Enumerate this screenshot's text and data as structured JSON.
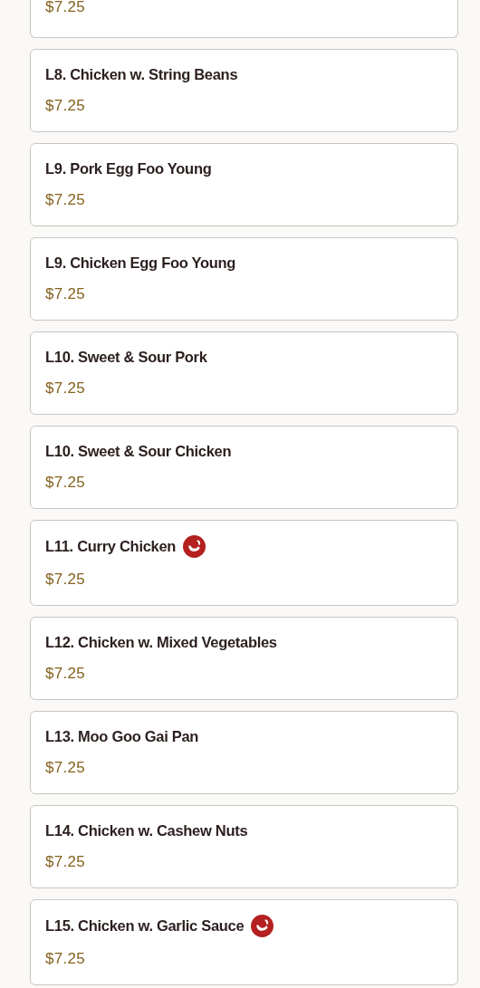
{
  "menu_items": [
    {
      "price": "$7.25",
      "cut": true
    },
    {
      "name": "L8. Chicken w. String Beans",
      "price": "$7.25",
      "spicy": false
    },
    {
      "name": "L9. Pork Egg Foo Young",
      "price": "$7.25",
      "spicy": false
    },
    {
      "name": "L9. Chicken Egg Foo Young",
      "price": "$7.25",
      "spicy": false
    },
    {
      "name": "L10. Sweet & Sour Pork",
      "price": "$7.25",
      "spicy": false
    },
    {
      "name": "L10. Sweet & Sour Chicken",
      "price": "$7.25",
      "spicy": false
    },
    {
      "name": "L11. Curry Chicken",
      "price": "$7.25",
      "spicy": true
    },
    {
      "name": "L12. Chicken w. Mixed Vegetables",
      "price": "$7.25",
      "spicy": false
    },
    {
      "name": "L13. Moo Goo Gai Pan",
      "price": "$7.25",
      "spicy": false
    },
    {
      "name": "L14. Chicken w. Cashew Nuts",
      "price": "$7.25",
      "spicy": false
    },
    {
      "name": "L15. Chicken w. Garlic Sauce",
      "price": "$7.25",
      "spicy": true
    }
  ]
}
